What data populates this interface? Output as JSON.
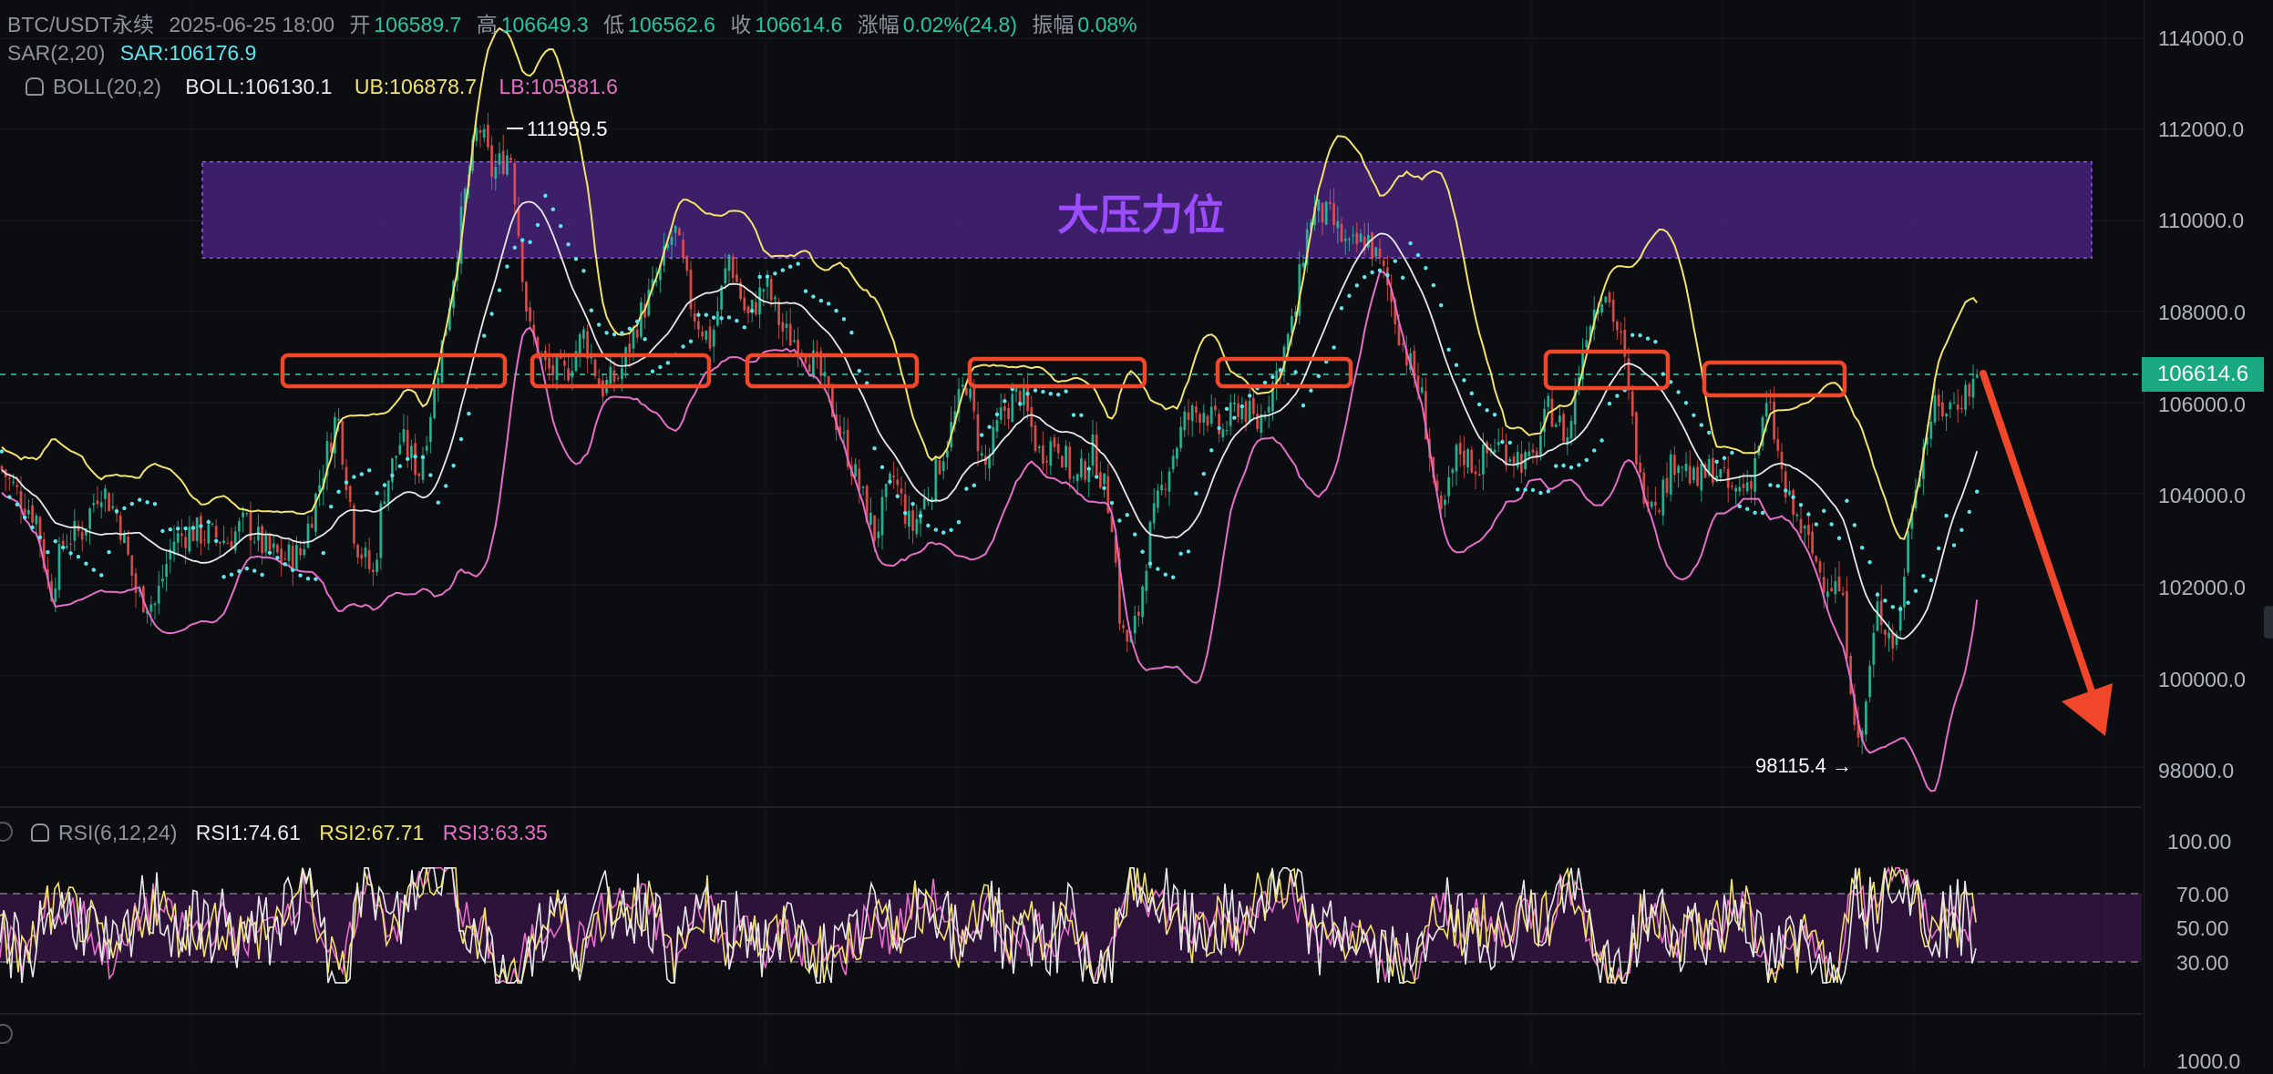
{
  "header": {
    "symbol": "BTC/USDT永续",
    "datetime": "2025-06-25 18:00",
    "open_label": "开",
    "open": "106589.7",
    "high_label": "高",
    "high": "106649.3",
    "low_label": "低",
    "low": "106562.6",
    "close_label": "收",
    "close": "106614.6",
    "change_label": "涨幅",
    "change": "0.02%(24.8)",
    "amplitude_label": "振幅",
    "amplitude": "0.08%"
  },
  "indicators": {
    "sar_name": "SAR(2,20)",
    "sar_value": "SAR:106176.9",
    "boll_name": "BOLL(20,2)",
    "boll_value": "BOLL:106130.1",
    "ub_value": "UB:106878.7",
    "lb_value": "LB:105381.6",
    "rsi_name": "RSI(6,12,24)",
    "rsi1": "RSI1:74.61",
    "rsi2": "RSI2:67.71",
    "rsi3": "RSI3:63.35"
  },
  "annotations": {
    "resistance_label": "大压力位",
    "high_marker": "111959.5",
    "low_marker": "98115.4 →"
  },
  "price_axis": {
    "ticks": [
      "114000.0",
      "112000.0",
      "110000.0",
      "108000.0",
      "106000.0",
      "104000.0",
      "102000.0",
      "100000.0",
      "98000.0"
    ],
    "last_price": "106614.6"
  },
  "rsi_axis": {
    "ticks": [
      "100.00",
      "70.00",
      "50.00",
      "30.00"
    ]
  },
  "volume_axis": {
    "ticks": [
      "1000.0"
    ]
  },
  "colors": {
    "up": "#26c6a2",
    "down": "#ef5350",
    "boll_mid": "#e8e8e8",
    "boll_ub": "#f3e26b",
    "boll_lb": "#e56ec8",
    "sar": "#5fe5ee",
    "resistance_zone": "#5b2aa0",
    "marker_box": "#f0462a"
  },
  "chart_data": {
    "type": "line",
    "title": "",
    "price_range": [
      97500,
      114500
    ],
    "price_path": [
      [
        0,
        104600
      ],
      [
        20,
        104000
      ],
      [
        40,
        103500
      ],
      [
        55,
        101800
      ],
      [
        70,
        103000
      ],
      [
        90,
        103200
      ],
      [
        110,
        104200
      ],
      [
        130,
        103500
      ],
      [
        150,
        101800
      ],
      [
        170,
        101600
      ],
      [
        190,
        103000
      ],
      [
        210,
        103200
      ],
      [
        230,
        103100
      ],
      [
        250,
        103000
      ],
      [
        270,
        103400
      ],
      [
        290,
        102800
      ],
      [
        310,
        102600
      ],
      [
        330,
        102700
      ],
      [
        350,
        104200
      ],
      [
        370,
        105800
      ],
      [
        390,
        103000
      ],
      [
        410,
        102200
      ],
      [
        420,
        104000
      ],
      [
        440,
        105200
      ],
      [
        460,
        104500
      ],
      [
        470,
        105600
      ],
      [
        490,
        107800
      ],
      [
        510,
        110500
      ],
      [
        525,
        112100
      ],
      [
        540,
        111000
      ],
      [
        560,
        111500
      ],
      [
        580,
        107600
      ],
      [
        600,
        106700
      ],
      [
        620,
        106600
      ],
      [
        640,
        107500
      ],
      [
        660,
        106300
      ],
      [
        680,
        106600
      ],
      [
        700,
        107800
      ],
      [
        720,
        108600
      ],
      [
        740,
        109800
      ],
      [
        760,
        108000
      ],
      [
        780,
        107300
      ],
      [
        800,
        109200
      ],
      [
        820,
        107800
      ],
      [
        840,
        108600
      ],
      [
        860,
        107500
      ],
      [
        880,
        107300
      ],
      [
        900,
        106600
      ],
      [
        920,
        105500
      ],
      [
        940,
        104300
      ],
      [
        960,
        103100
      ],
      [
        980,
        104400
      ],
      [
        1000,
        103200
      ],
      [
        1020,
        104100
      ],
      [
        1040,
        105200
      ],
      [
        1060,
        106500
      ],
      [
        1080,
        104500
      ],
      [
        1100,
        105800
      ],
      [
        1120,
        106200
      ],
      [
        1140,
        104900
      ],
      [
        1160,
        105200
      ],
      [
        1180,
        104200
      ],
      [
        1200,
        105000
      ],
      [
        1220,
        103500
      ],
      [
        1230,
        101000
      ],
      [
        1240,
        100700
      ],
      [
        1250,
        101500
      ],
      [
        1260,
        103000
      ],
      [
        1280,
        104500
      ],
      [
        1300,
        105600
      ],
      [
        1320,
        105900
      ],
      [
        1340,
        105300
      ],
      [
        1360,
        106000
      ],
      [
        1380,
        105500
      ],
      [
        1400,
        106600
      ],
      [
        1420,
        107800
      ],
      [
        1430,
        109300
      ],
      [
        1440,
        110200
      ],
      [
        1460,
        110000
      ],
      [
        1480,
        109300
      ],
      [
        1500,
        109600
      ],
      [
        1520,
        108700
      ],
      [
        1540,
        107200
      ],
      [
        1560,
        106100
      ],
      [
        1580,
        103300
      ],
      [
        1600,
        105000
      ],
      [
        1620,
        104600
      ],
      [
        1640,
        105100
      ],
      [
        1660,
        104900
      ],
      [
        1680,
        104600
      ],
      [
        1700,
        105900
      ],
      [
        1720,
        105200
      ],
      [
        1740,
        107600
      ],
      [
        1760,
        108600
      ],
      [
        1780,
        107200
      ],
      [
        1800,
        104200
      ],
      [
        1820,
        103900
      ],
      [
        1840,
        104900
      ],
      [
        1860,
        104200
      ],
      [
        1880,
        104600
      ],
      [
        1900,
        104000
      ],
      [
        1920,
        104300
      ],
      [
        1940,
        106000
      ],
      [
        1960,
        103900
      ],
      [
        1980,
        103100
      ],
      [
        2000,
        102200
      ],
      [
        2020,
        101900
      ],
      [
        2040,
        98300
      ],
      [
        2060,
        101500
      ],
      [
        2080,
        100700
      ],
      [
        2100,
        104200
      ],
      [
        2120,
        105800
      ],
      [
        2140,
        105900
      ],
      [
        2160,
        106300
      ],
      [
        2170,
        106600
      ]
    ],
    "high": 111959.5,
    "low": 98115.4,
    "last": 106614.6,
    "resistance_zone": [
      109150,
      111250
    ],
    "rsi_range": [
      0,
      100
    ],
    "rsi_levels": [
      70,
      50,
      30
    ]
  }
}
